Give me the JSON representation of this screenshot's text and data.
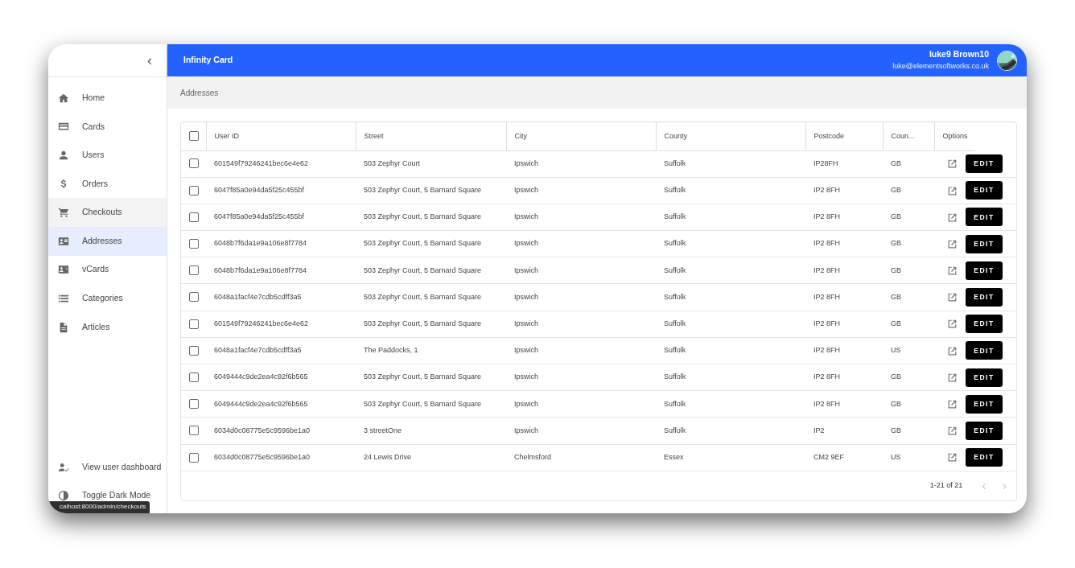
{
  "sidebar": {
    "collapse_label": "‹",
    "items": [
      {
        "label": "Home",
        "selected": false,
        "hovered": false
      },
      {
        "label": "Cards",
        "selected": false,
        "hovered": false
      },
      {
        "label": "Users",
        "selected": false,
        "hovered": false
      },
      {
        "label": "Orders",
        "selected": false,
        "hovered": false
      },
      {
        "label": "Checkouts",
        "selected": false,
        "hovered": true
      },
      {
        "label": "Addresses",
        "selected": true,
        "hovered": false
      },
      {
        "label": "vCards",
        "selected": false,
        "hovered": false
      },
      {
        "label": "Categories",
        "selected": false,
        "hovered": false
      },
      {
        "label": "Articles",
        "selected": false,
        "hovered": false
      }
    ],
    "bottom_items": [
      {
        "label": "View user dashboard"
      },
      {
        "label": "Toggle Dark Mode"
      }
    ]
  },
  "topbar": {
    "title": "Infinity Card",
    "user_name": "luke9 Brown10",
    "user_email": "luke@elementsoftworks.co.uk"
  },
  "breadcrumb": "Addresses",
  "table": {
    "select_all_checked": false,
    "columns": [
      "User ID",
      "Street",
      "City",
      "County",
      "Postcode",
      "Coun...",
      "Options"
    ],
    "rows": [
      {
        "checked": false,
        "cells": [
          "601549f79246241bec6e4e62",
          "503 Zephyr Court",
          "Ipswich",
          "Suffolk",
          "IP28FH",
          "GB"
        ],
        "action": "EDIT"
      },
      {
        "checked": false,
        "cells": [
          "6047f85a0e94da5f25c455bf",
          "503 Zephyr Court, 5 Barnard Square",
          "Ipswich",
          "Suffolk",
          "IP2 8FH",
          "GB"
        ],
        "action": "EDIT"
      },
      {
        "checked": false,
        "cells": [
          "6047f85a0e94da5f25c455bf",
          "503 Zephyr Court, 5 Barnard Square",
          "Ipswich",
          "Suffolk",
          "IP2 8FH",
          "GB"
        ],
        "action": "EDIT"
      },
      {
        "checked": false,
        "cells": [
          "6048b7f6da1e9a106e8f7784",
          "503 Zephyr Court, 5 Barnard Square",
          "Ipswich",
          "Suffolk",
          "IP2 8FH",
          "GB"
        ],
        "action": "EDIT"
      },
      {
        "checked": false,
        "cells": [
          "6048b7f6da1e9a106e8f7784",
          "503 Zephyr Court, 5 Barnard Square",
          "Ipswich",
          "Suffolk",
          "IP2 8FH",
          "GB"
        ],
        "action": "EDIT"
      },
      {
        "checked": false,
        "cells": [
          "6048a1facf4e7cdb5cdff3a5",
          "503 Zephyr Court, 5 Barnard Square",
          "Ipswich",
          "Suffolk",
          "IP2 8FH",
          "GB"
        ],
        "action": "EDIT"
      },
      {
        "checked": false,
        "cells": [
          "601549f79246241bec6e4e62",
          "503 Zephyr Court, 5 Barnard Square",
          "Ipswich",
          "Suffolk",
          "IP2 8FH",
          "GB"
        ],
        "action": "EDIT"
      },
      {
        "checked": false,
        "cells": [
          "6048a1facf4e7cdb5cdff3a5",
          "The Paddocks, 1",
          "Ipswich",
          "Suffolk",
          "IP2 8FH",
          "US"
        ],
        "action": "EDIT"
      },
      {
        "checked": false,
        "cells": [
          "6049444c9de2ea4c92f6b565",
          "503 Zephyr Court, 5 Barnard Square",
          "Ipswich",
          "Suffolk",
          "IP2 8FH",
          "GB"
        ],
        "action": "EDIT"
      },
      {
        "checked": false,
        "cells": [
          "6049444c9de2ea4c92f6b565",
          "503 Zephyr Court, 5 Barnard Square",
          "Ipswich",
          "Suffolk",
          "IP2 8FH",
          "GB"
        ],
        "action": "EDIT"
      },
      {
        "checked": false,
        "cells": [
          "6034d0c08775e5c9596be1a0",
          "3 streetOne",
          "Ipswich",
          "Suffolk",
          "IP2",
          "GB"
        ],
        "action": "EDIT"
      },
      {
        "checked": false,
        "cells": [
          "6034d0c08775e5c9596be1a0",
          "24 Lewis Drive",
          "Chelmsford",
          "Essex",
          "CM2 9EF",
          "US"
        ],
        "action": "EDIT"
      }
    ],
    "pagination": {
      "range": "1-21 of 21",
      "prev_label": "‹",
      "next_label": "›",
      "prev_disabled": true,
      "next_disabled": true
    }
  },
  "status_tooltip": "calhost:8000/admin/checkouts"
}
